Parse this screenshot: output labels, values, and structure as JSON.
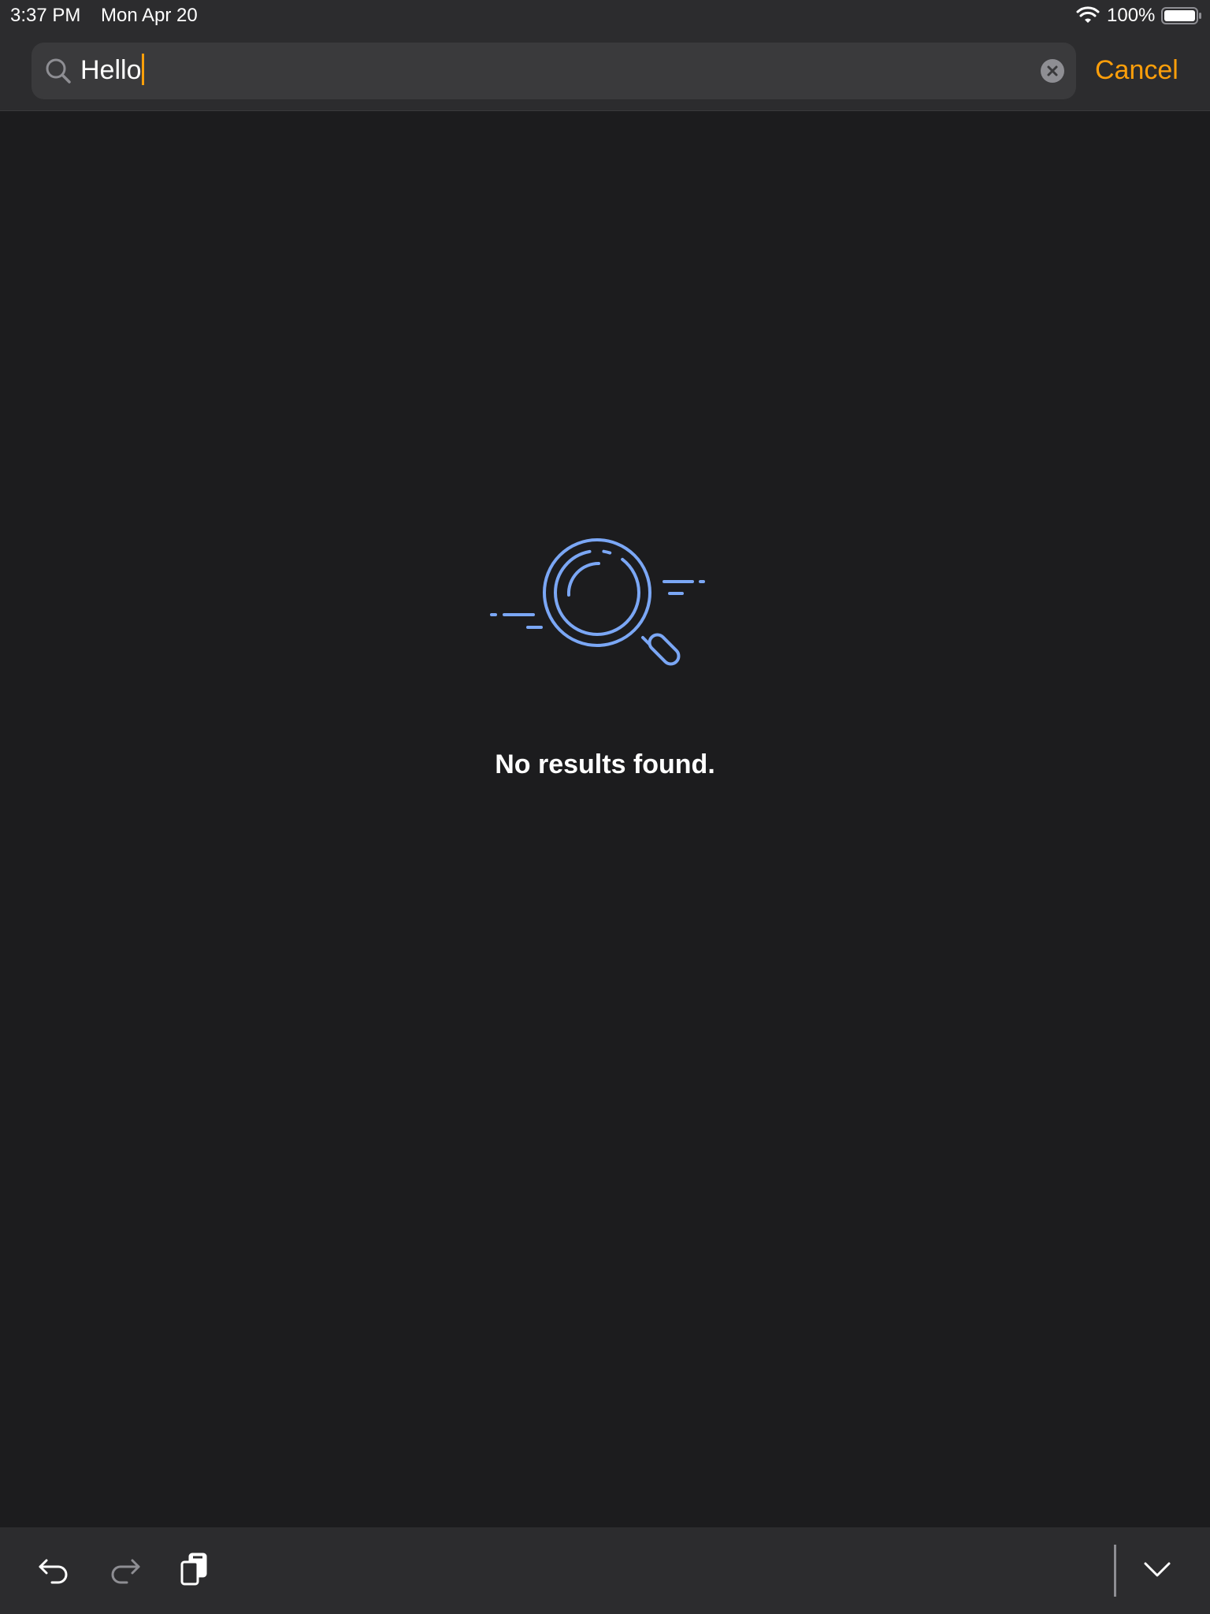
{
  "status_bar": {
    "time": "3:37 PM",
    "date": "Mon Apr 20",
    "battery": "100%"
  },
  "search": {
    "query": "Hello",
    "cancel_label": "Cancel"
  },
  "empty_state": {
    "message": "No results found."
  },
  "icons": {
    "wifi": "wifi-icon",
    "battery": "battery-icon",
    "search": "search-icon",
    "clear": "clear-icon",
    "illustration": "magnifier-illustration",
    "undo": "undo-icon",
    "redo": "redo-icon",
    "paste": "paste-icon",
    "dismiss": "chevron-down-icon"
  },
  "colors": {
    "accent": "#ff9f0a",
    "illustration": "#7ba7f5",
    "background": "#1c1c1e",
    "bar": "#2c2c2e"
  }
}
